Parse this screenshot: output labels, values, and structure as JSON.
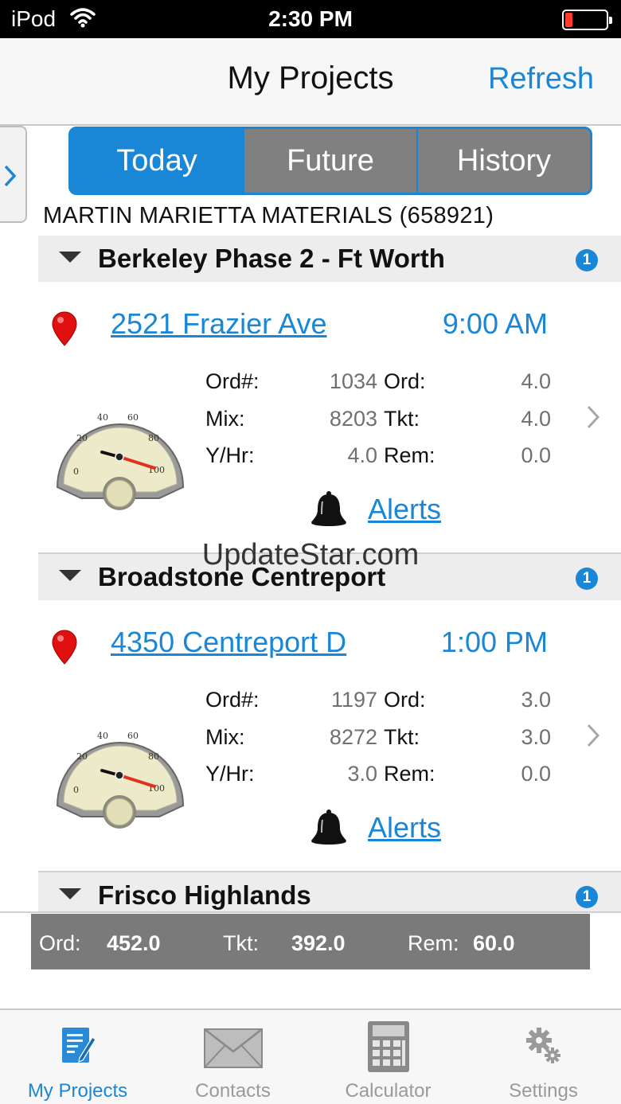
{
  "status_bar": {
    "carrier": "iPod",
    "time": "2:30 PM"
  },
  "nav": {
    "title": "My Projects",
    "refresh_label": "Refresh"
  },
  "segments": {
    "today": "Today",
    "future": "Future",
    "history": "History"
  },
  "company": "MARTIN MARIETTA MATERIALS (658921)",
  "projects": [
    {
      "name": "Berkeley Phase 2 - Ft Worth",
      "badge": "1",
      "address": "2521 Frazier Ave",
      "time": "9:00 AM",
      "order_label": "Ord#:",
      "order_no": "1034",
      "mix_label": "Mix:",
      "mix": "8203",
      "yhr_label": "Y/Hr:",
      "yhr": "4.0",
      "ord_label": "Ord:",
      "ord": "4.0",
      "tkt_label": "Tkt:",
      "tkt": "4.0",
      "rem_label": "Rem:",
      "rem": "0.0",
      "alerts_label": "Alerts",
      "gauge_ticks": [
        "0",
        "20",
        "40",
        "60",
        "80",
        "100"
      ]
    },
    {
      "name": "Broadstone Centreport",
      "badge": "1",
      "address": "4350 Centreport D",
      "time": "1:00 PM",
      "order_label": "Ord#:",
      "order_no": "1197",
      "mix_label": "Mix:",
      "mix": "8272",
      "yhr_label": "Y/Hr:",
      "yhr": "3.0",
      "ord_label": "Ord:",
      "ord": "3.0",
      "tkt_label": "Tkt:",
      "tkt": "3.0",
      "rem_label": "Rem:",
      "rem": "0.0",
      "alerts_label": "Alerts",
      "gauge_ticks": [
        "0",
        "20",
        "40",
        "60",
        "80",
        "100"
      ]
    },
    {
      "name": "Frisco Highlands",
      "badge": "1"
    }
  ],
  "watermark": "UpdateStar.com",
  "totals": {
    "ord_label": "Ord:",
    "ord": "452.0",
    "tkt_label": "Tkt:",
    "tkt": "392.0",
    "rem_label": "Rem:",
    "rem": "60.0"
  },
  "tabs": [
    {
      "label": "My Projects",
      "icon": "document-icon"
    },
    {
      "label": "Contacts",
      "icon": "envelope-icon"
    },
    {
      "label": "Calculator",
      "icon": "calculator-icon"
    },
    {
      "label": "Settings",
      "icon": "gear-icon"
    }
  ],
  "colors": {
    "accent": "#1a87d6",
    "segment_inactive": "#808080",
    "totals_bg": "#7a7a7a",
    "pin": "#e01010",
    "needle_red": "#e03020"
  }
}
